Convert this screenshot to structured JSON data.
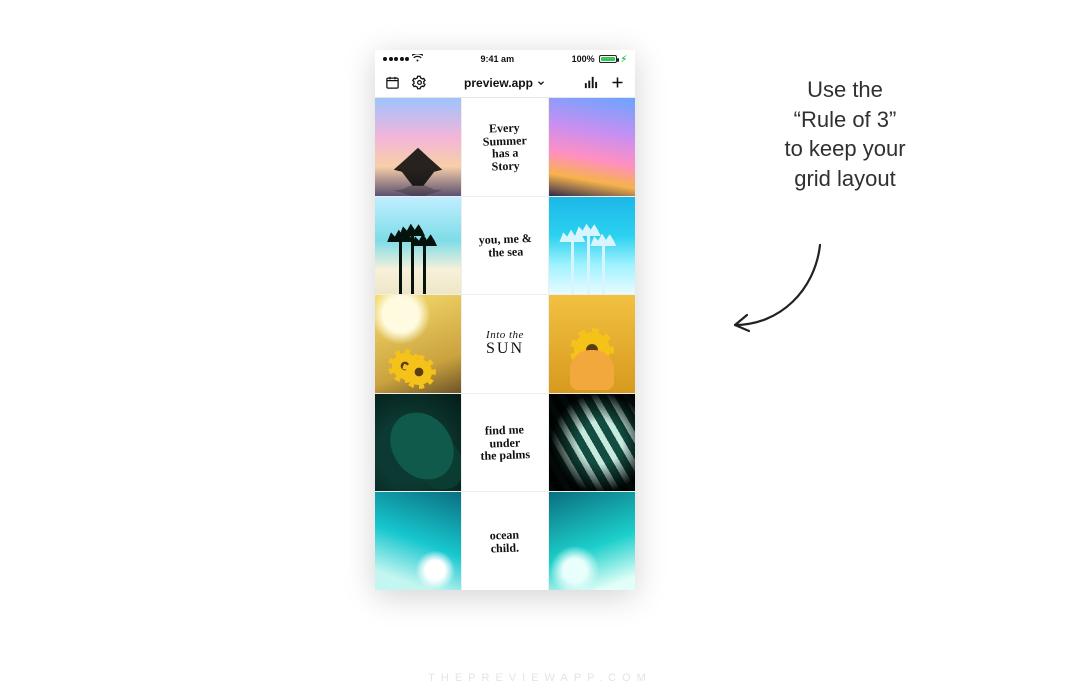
{
  "status": {
    "time": "9:41 am",
    "battery_pct": "100%"
  },
  "toolbar": {
    "title": "preview.app"
  },
  "grid": {
    "quotes": {
      "r0": "Every\nSummer\nhas a\nStory",
      "r1": "you, me &\nthe sea",
      "r2_top": "Into the",
      "r2_caps": "SUN",
      "r3": "find me\nunder\nthe palms",
      "r4": "ocean\nchild."
    }
  },
  "note": {
    "l1": "Use the",
    "l2": "“Rule of 3”",
    "l3": "to keep your",
    "l4": "grid layout"
  },
  "watermark": "THEPREVIEWAPP.COM"
}
